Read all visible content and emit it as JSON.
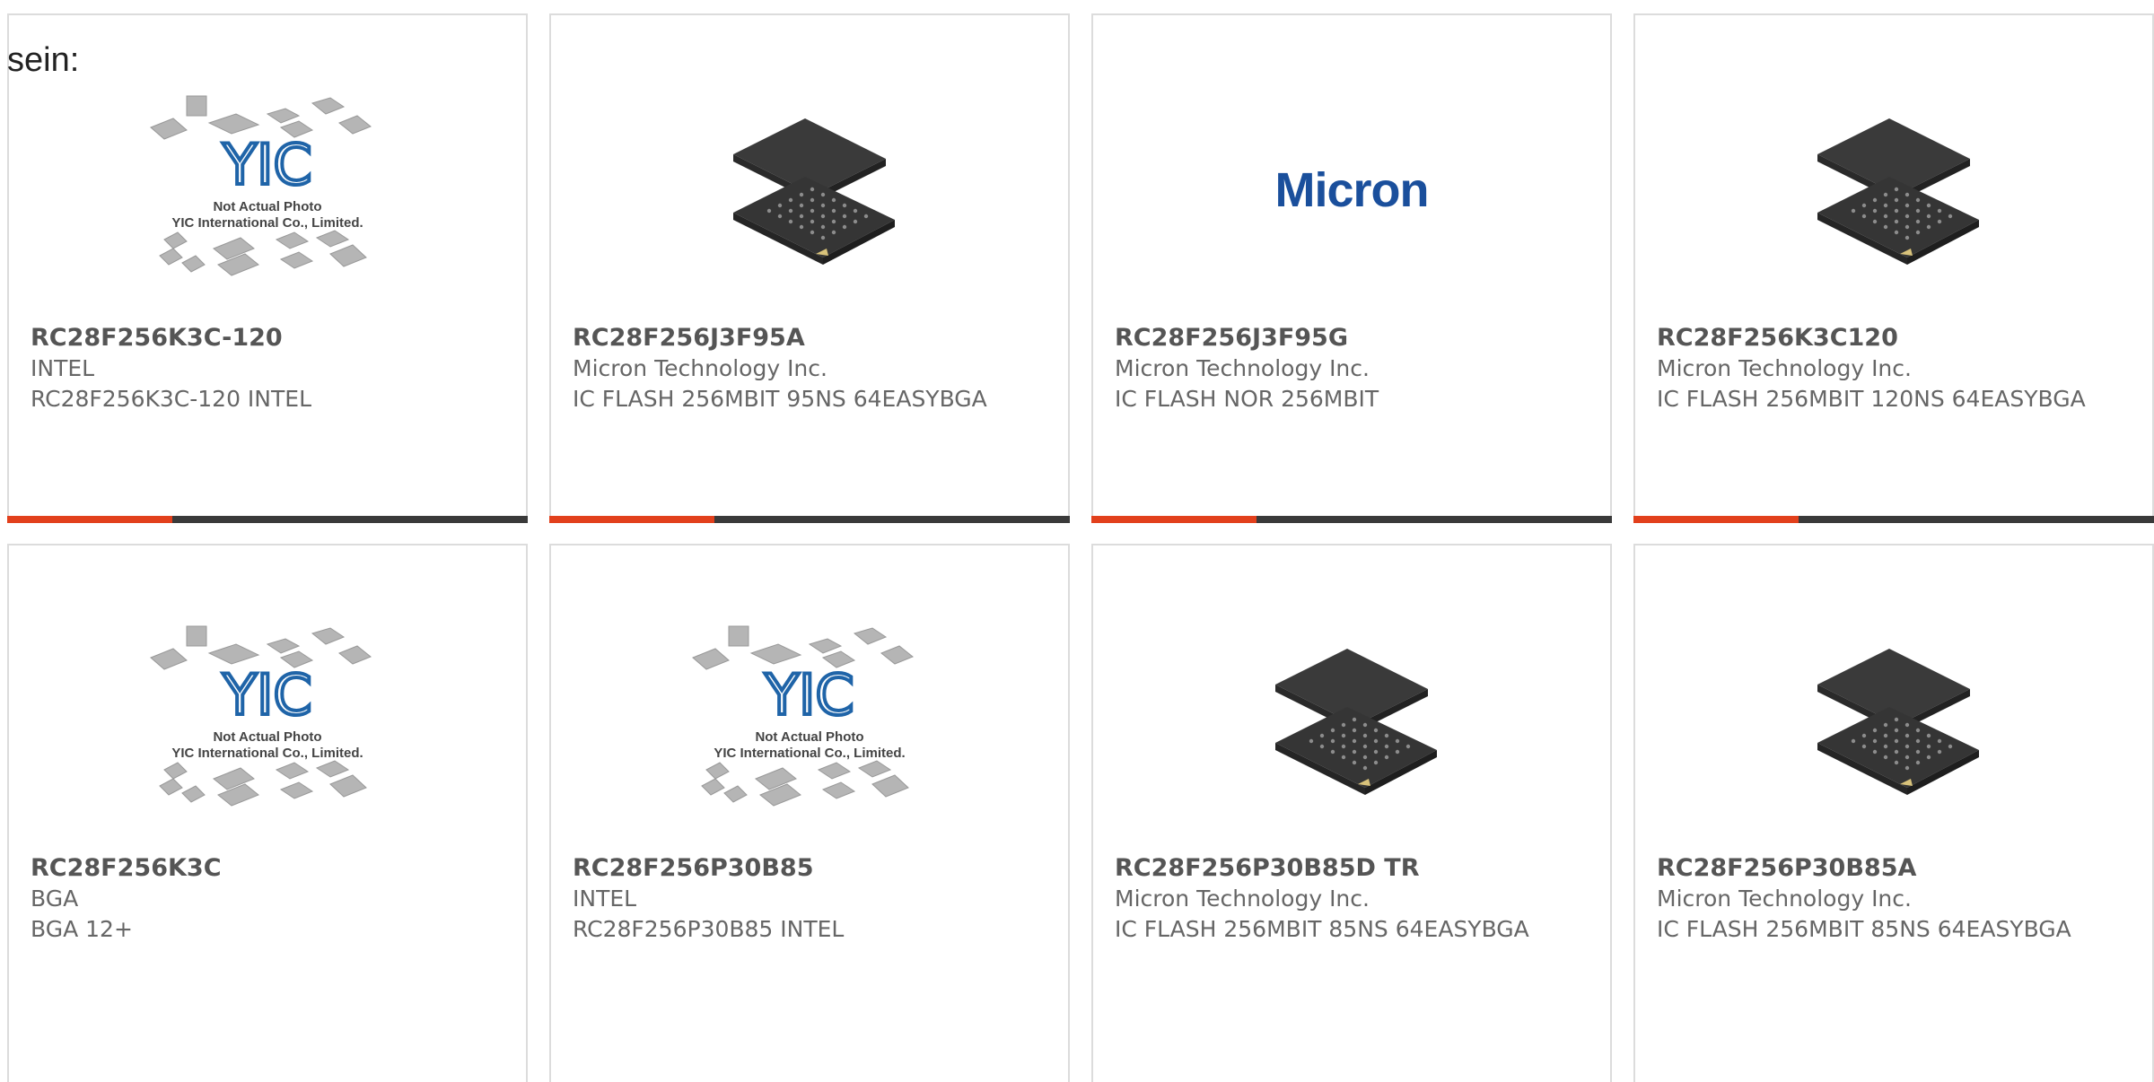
{
  "page": {
    "label": "sein:"
  },
  "colors": {
    "accent": "#e2401c",
    "bar": "#3a3a3a",
    "border": "#dcdcdc",
    "micron_blue": "#1a4f9c"
  },
  "placeholder": {
    "brand": "YIC",
    "line1": "Not Actual Photo",
    "line2": "YIC International Co., Limited."
  },
  "micron_logo": "Micron",
  "cards": [
    {
      "part_no": "RC28F256K3C-120",
      "manufacturer": "INTEL",
      "description": "RC28F256K3C-120 INTEL",
      "image": "yic-placeholder"
    },
    {
      "part_no": "RC28F256J3F95A",
      "manufacturer": "Micron Technology Inc.",
      "description": "IC FLASH 256MBIT 95NS 64EASYBGA",
      "image": "bga-chip"
    },
    {
      "part_no": "RC28F256J3F95G",
      "manufacturer": "Micron Technology Inc.",
      "description": "IC FLASH NOR 256MBIT",
      "image": "micron-logo"
    },
    {
      "part_no": "RC28F256K3C120",
      "manufacturer": "Micron Technology Inc.",
      "description": "IC FLASH 256MBIT 120NS 64EASYBGA",
      "image": "bga-chip"
    },
    {
      "part_no": "RC28F256K3C",
      "manufacturer": "BGA",
      "description": "BGA 12+",
      "image": "yic-placeholder"
    },
    {
      "part_no": "RC28F256P30B85",
      "manufacturer": "INTEL",
      "description": "RC28F256P30B85 INTEL",
      "image": "yic-placeholder"
    },
    {
      "part_no": "RC28F256P30B85D TR",
      "manufacturer": "Micron Technology Inc.",
      "description": "IC FLASH 256MBIT 85NS 64EASYBGA",
      "image": "bga-chip"
    },
    {
      "part_no": "RC28F256P30B85A",
      "manufacturer": "Micron Technology Inc.",
      "description": "IC FLASH 256MBIT 85NS 64EASYBGA",
      "image": "bga-chip"
    }
  ]
}
